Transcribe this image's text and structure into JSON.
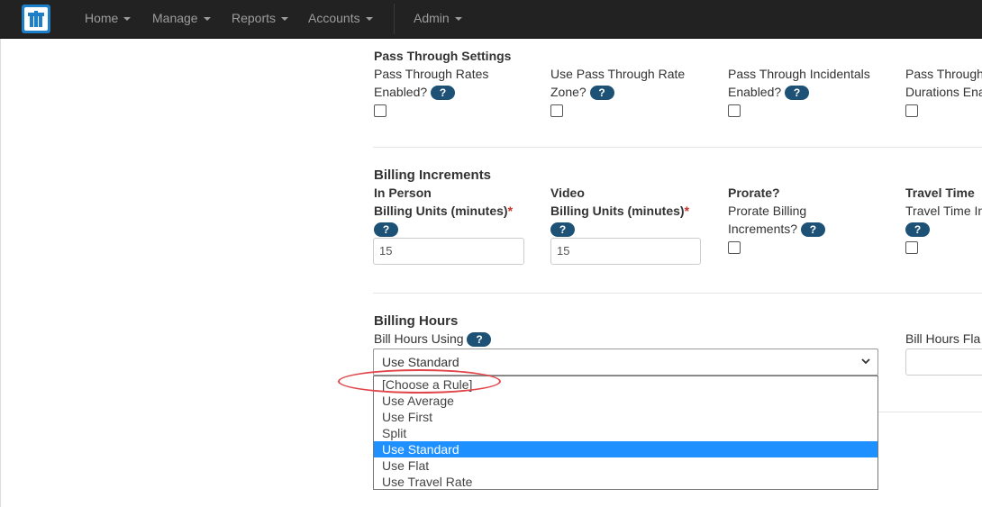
{
  "nav": {
    "items": [
      "Home",
      "Manage",
      "Reports",
      "Accounts"
    ],
    "admin": "Admin"
  },
  "pass_through": {
    "title": "Pass Through Settings",
    "fields": [
      {
        "line1": "Pass Through Rates",
        "line2": "Enabled?"
      },
      {
        "line1": "Use Pass Through Rate",
        "line2": "Zone?"
      },
      {
        "line1": "Pass Through Incidentals",
        "line2": "Enabled?"
      },
      {
        "line1": "Pass Through",
        "line2": "Durations Ena"
      }
    ]
  },
  "billing_increments": {
    "title": "Billing Increments",
    "in_person": {
      "heading": "In Person",
      "label": "Billing Units (minutes)",
      "value": "15"
    },
    "video": {
      "heading": "Video",
      "label": "Billing Units (minutes)",
      "value": "15"
    },
    "prorate": {
      "heading": "Prorate?",
      "line1": "Prorate Billing",
      "line2": "Increments?"
    },
    "travel": {
      "heading": "Travel Time",
      "line1": "Travel Time In"
    }
  },
  "billing_hours": {
    "title": "Billing Hours",
    "label": "Bill Hours Using",
    "selected": "Use Standard",
    "options": [
      "[Choose a Rule]",
      "Use Average",
      "Use First",
      "Split",
      "Use Standard",
      "Use Flat",
      "Use Travel Rate"
    ],
    "selected_index": 4,
    "flat_label": "Bill Hours Fla"
  },
  "help_text": "?",
  "required_mark": "*",
  "colors": {
    "help_badge": "#1d5276",
    "highlight": "#1e90ff",
    "annotation": "#e0454a"
  }
}
